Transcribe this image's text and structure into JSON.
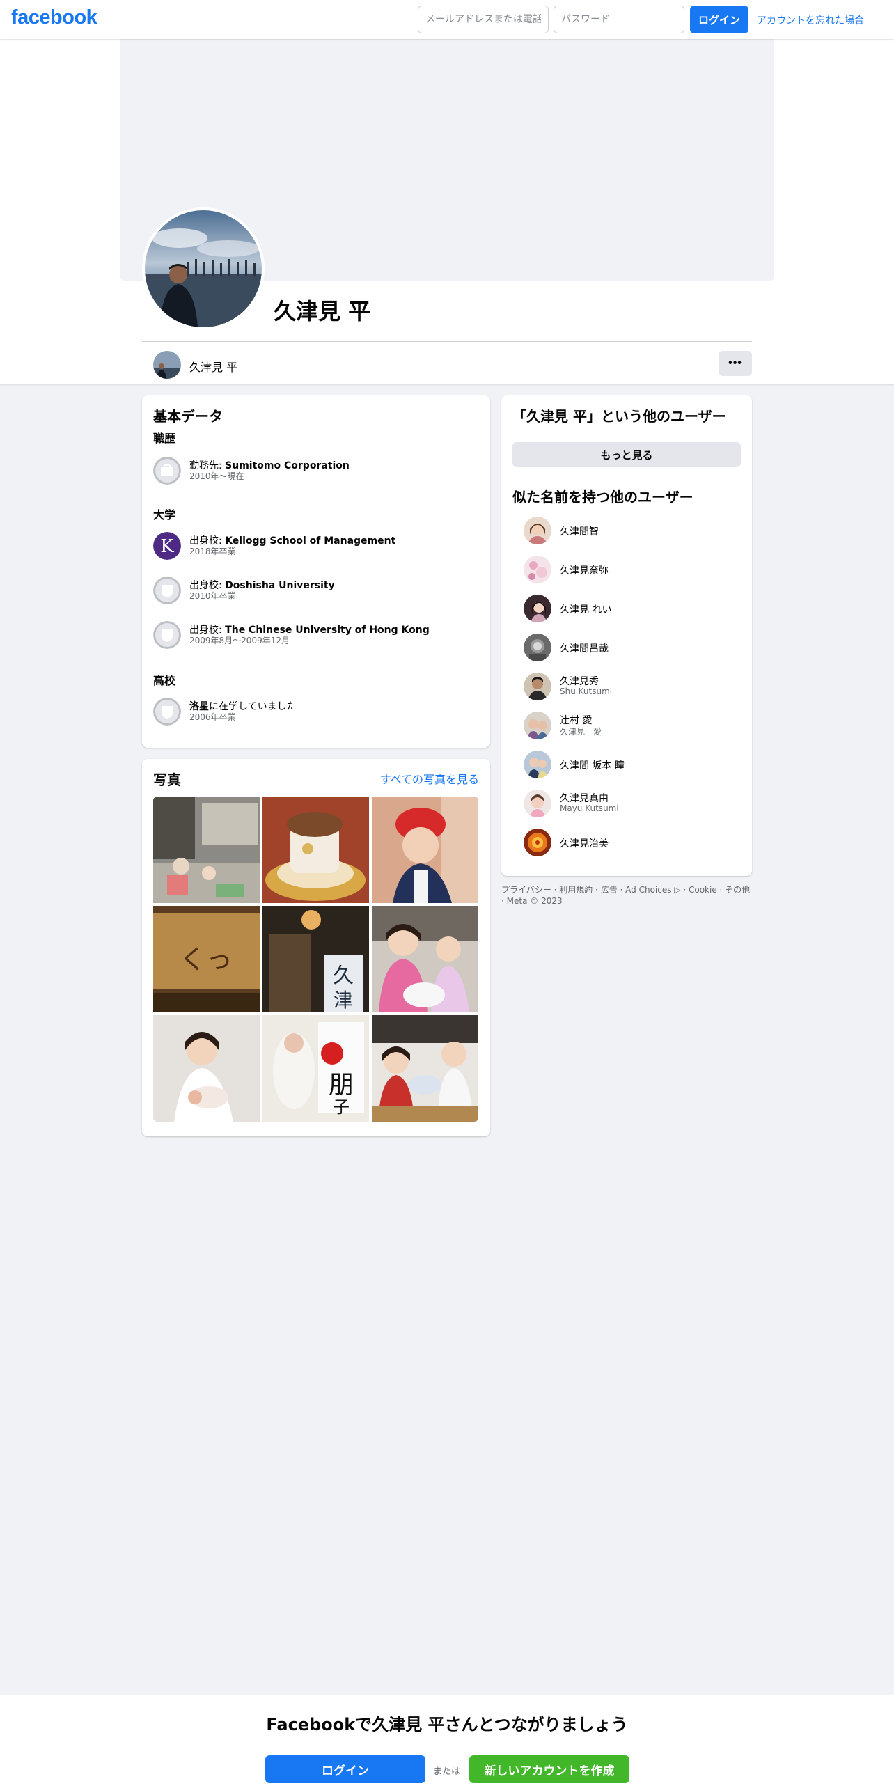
{
  "topbar": {
    "logo": "facebook",
    "email_placeholder": "メールアドレスまたは電話番号",
    "password_placeholder": "パスワード",
    "login_label": "ログイン",
    "forgot_label": "アカウントを忘れた場合"
  },
  "profile": {
    "name": "久津見 平",
    "tab_name": "久津見 平",
    "more_label": "•••"
  },
  "about": {
    "title": "基本データ",
    "work_title": "職歴",
    "work": [
      {
        "prefix": "勤務先: ",
        "name": "Sumitomo Corporation",
        "sub": "2010年～現在",
        "icon": "briefcase-icon"
      }
    ],
    "college_title": "大学",
    "college": [
      {
        "prefix": "出身校: ",
        "name": "Kellogg School of Management",
        "sub": "2018年卒業",
        "icon": "kellogg-logo"
      },
      {
        "prefix": "出身校: ",
        "name": "Doshisha University",
        "sub": "2010年卒業",
        "icon": "school-icon"
      },
      {
        "prefix": "出身校: ",
        "name": "The Chinese University of Hong Kong",
        "sub": "2009年8月〜2009年12月",
        "icon": "school-icon"
      }
    ],
    "highschool_title": "高校",
    "highschool": [
      {
        "name": "洛星",
        "suffix": "に在学していました",
        "sub": "2006年卒業",
        "icon": "school-icon"
      }
    ]
  },
  "photos": {
    "title": "写真",
    "see_all": "すべての写真を見る"
  },
  "others": {
    "title": "「久津見 平」という他のユーザー",
    "see_more": "もっと見る",
    "similar_title": "似た名前を持つ他のユーザー",
    "people": [
      {
        "name": "久津間智",
        "sub": ""
      },
      {
        "name": "久津見奈弥",
        "sub": ""
      },
      {
        "name": "久津見 れい",
        "sub": ""
      },
      {
        "name": "久津間昌哉",
        "sub": ""
      },
      {
        "name": "久津見秀",
        "sub": "Shu Kutsumi"
      },
      {
        "name": "辻村 愛",
        "sub": "久津見　愛"
      },
      {
        "name": "久津間 坂本 瞳",
        "sub": ""
      },
      {
        "name": "久津見真由",
        "sub": "Mayu Kutsumi"
      },
      {
        "name": "久津見治美",
        "sub": ""
      }
    ]
  },
  "footer": {
    "links": [
      "プライバシー",
      "利用規約",
      "広告",
      "Ad Choices ▷",
      "Cookie",
      "その他",
      "Meta © 2023"
    ]
  },
  "bottom": {
    "title": "Facebookで久津見 平さんとつながりましょう",
    "login_label": "ログイン",
    "or_label": "または",
    "create_label": "新しいアカウントを作成"
  },
  "colors": {
    "brand": "#1877f2",
    "create": "#42b72a",
    "background": "#f0f2f5"
  }
}
